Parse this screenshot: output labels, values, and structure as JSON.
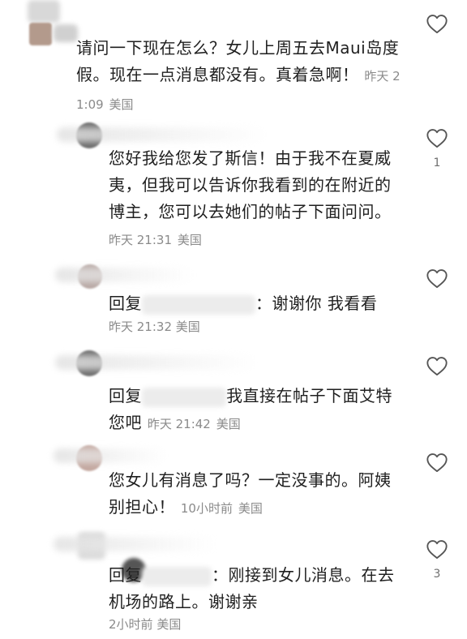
{
  "comments": [
    {
      "text": "请问一下现在怎么？女儿上周五去Maui岛度假。现在一点消息都没有。真着急啊！",
      "time": "昨天 21:09",
      "location": "美国",
      "likes": ""
    },
    {
      "text": "您好我给您发了斯信！由于我不在夏威夷，但我可以告诉你我看到的在附近的博主，您可以去她们的帖子下面问问。",
      "time": "昨天 21:31",
      "location": "美国",
      "likes": "1"
    },
    {
      "prefix": "回复",
      "text": "：谢谢你 我看看",
      "time": "昨天 21:32",
      "location": "美国",
      "likes": ""
    },
    {
      "prefix": "回复",
      "text": "我直接在帖子下面艾特您吧",
      "time": "昨天 21:42",
      "location": "美国",
      "likes": ""
    },
    {
      "text": "您女儿有消息了吗？一定没事的。阿姨别担心！",
      "time": "10小时前",
      "location": "美国",
      "likes": ""
    },
    {
      "prefix": "回复",
      "text": "：刚接到女儿消息。在去机场的路上。谢谢亲",
      "time": "2小时前",
      "location": "美国",
      "likes": "3"
    }
  ],
  "colors": {
    "text": "#1f1f1f",
    "meta": "#8a8a8a",
    "icon": "#555555"
  },
  "icons": {
    "like": "heart-outline-icon"
  }
}
